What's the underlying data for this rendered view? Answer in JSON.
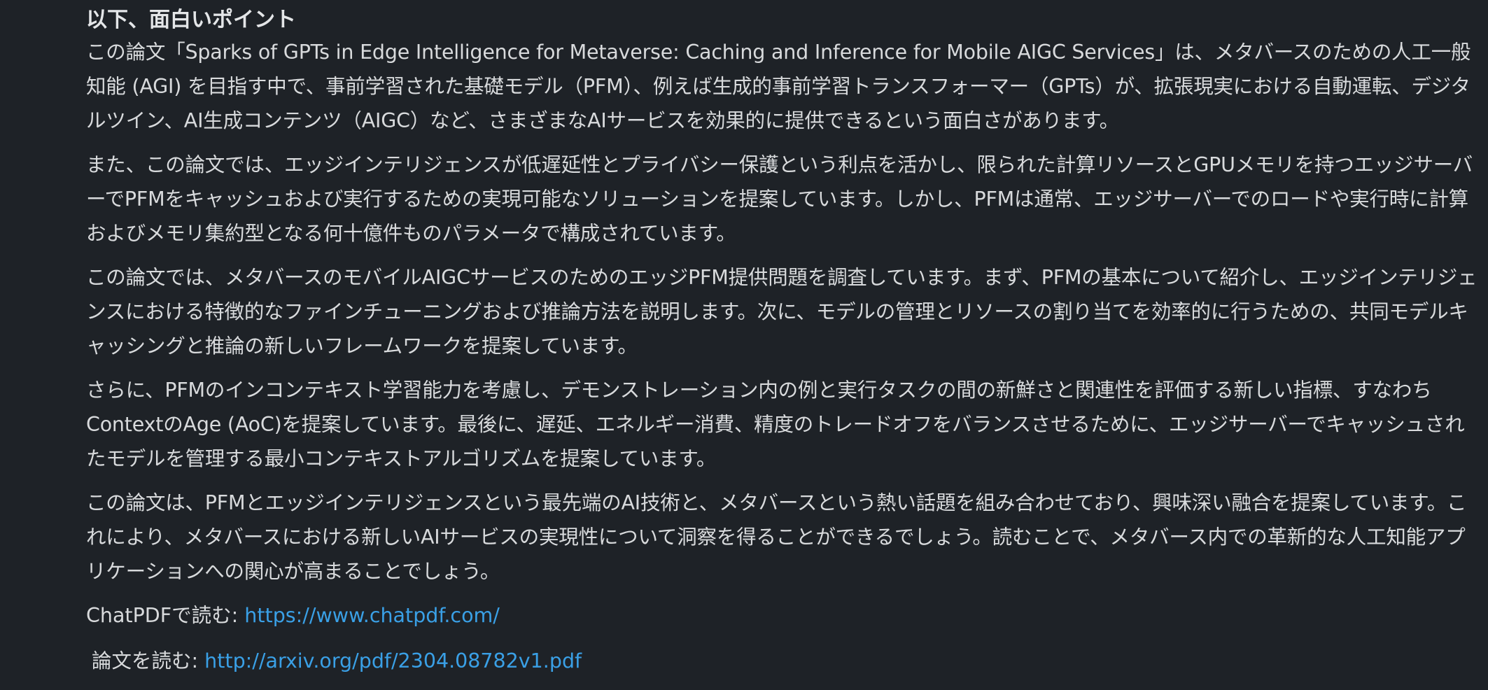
{
  "message": {
    "heading": "以下、面白いポイント",
    "paragraphs": [
      "この論文「Sparks of GPTs in Edge Intelligence for Metaverse: Caching and Inference for Mobile AIGC Services」は、メタバースのための人工一般知能 (AGI) を目指す中で、事前学習された基礎モデル（PFM）、例えば生成的事前学習トランスフォーマー（GPTs）が、拡張現実における自動運転、デジタルツイン、AI生成コンテンツ（AIGC）など、さまざまなAIサービスを効果的に提供できるという面白さがあります。",
      "また、この論文では、エッジインテリジェンスが低遅延性とプライバシー保護という利点を活かし、限られた計算リソースとGPUメモリを持つエッジサーバーでPFMをキャッシュおよび実行するための実現可能なソリューションを提案しています。しかし、PFMは通常、エッジサーバーでのロードや実行時に計算およびメモリ集約型となる何十億件ものパラメータで構成されています。",
      "この論文では、メタバースのモバイルAIGCサービスのためのエッジPFM提供問題を調査しています。まず、PFMの基本について紹介し、エッジインテリジェンスにおける特徴的なファインチューニングおよび推論方法を説明します。次に、モデルの管理とリソースの割り当てを効率的に行うための、共同モデルキャッシングと推論の新しいフレームワークを提案しています。",
      "さらに、PFMのインコンテキスト学習能力を考慮し、デモンストレーション内の例と実行タスクの間の新鮮さと関連性を評価する新しい指標、すなわちContextのAge (AoC)を提案しています。最後に、遅延、エネルギー消費、精度のトレードオフをバランスさせるために、エッジサーバーでキャッシュされたモデルを管理する最小コンテキストアルゴリズムを提案しています。",
      "この論文は、PFMとエッジインテリジェンスという最先端のAI技術と、メタバースという熱い話題を組み合わせており、興味深い融合を提案しています。これにより、メタバースにおける新しいAIサービスの実現性について洞察を得ることができるでしょう。読むことで、メタバース内での革新的な人工知能アプリケーションへの関心が高まることでしょう。"
    ],
    "chatpdf": {
      "label": "ChatPDFで読む: ",
      "url": "https://www.chatpdf.com/"
    },
    "paper": {
      "label": "論文を読む: ",
      "url": "http://arxiv.org/pdf/2304.08782v1.pdf"
    }
  },
  "colors": {
    "background": "#1e2227",
    "text": "#d8dadc",
    "link": "#3aa0e6"
  }
}
